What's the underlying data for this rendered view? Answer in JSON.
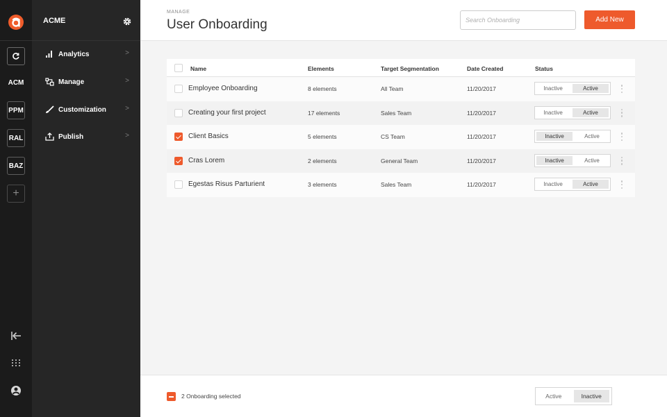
{
  "workspaces": [
    {
      "label": "ACM"
    },
    {
      "label": "PPM"
    },
    {
      "label": "RAL"
    },
    {
      "label": "BAZ"
    }
  ],
  "rail": {
    "add_label": "+"
  },
  "nav": {
    "title": "ACME",
    "items": [
      {
        "label": "Analytics",
        "icon": "bar-chart-icon"
      },
      {
        "label": "Manage",
        "icon": "flow-icon"
      },
      {
        "label": "Customization",
        "icon": "brush-icon"
      },
      {
        "label": "Publish",
        "icon": "upload-icon"
      }
    ],
    "chevron": ">"
  },
  "header": {
    "breadcrumb": "MANAGE",
    "title": "User Onboarding",
    "search_placeholder": "Search Onboarding",
    "add_button": "Add New"
  },
  "table": {
    "columns": [
      "Name",
      "Elements",
      "Target Segmentation",
      "Date Created",
      "Status"
    ],
    "rows": [
      {
        "name": "Employee Onboarding",
        "elements": "8 elements",
        "segment": "All Team",
        "date": "11/20/2017",
        "checked": false,
        "status": "Active"
      },
      {
        "name": "Creating your first project",
        "elements": "17 elements",
        "segment": "Sales Team",
        "date": "11/20/2017",
        "checked": false,
        "status": "Active"
      },
      {
        "name": "Client Basics",
        "elements": "5 elements",
        "segment": "CS Team",
        "date": "11/20/2017",
        "checked": true,
        "status": "Inactive"
      },
      {
        "name": "Cras Lorem",
        "elements": "2 elements",
        "segment": "General Team",
        "date": "11/20/2017",
        "checked": true,
        "status": "Inactive"
      },
      {
        "name": "Egestas Risus Parturient",
        "elements": "3 elements",
        "segment": "Sales Team",
        "date": "11/20/2017",
        "checked": false,
        "status": "Active"
      }
    ],
    "status_labels": {
      "inactive": "Inactive",
      "active": "Active"
    }
  },
  "footer": {
    "selected_text": "2 Onboarding selected",
    "active_label": "Active",
    "inactive_label": "Inactive",
    "selected_status": "Inactive"
  },
  "colors": {
    "accent": "#ee5a2c",
    "rail": "#1b1b1b",
    "nav": "#262626"
  }
}
